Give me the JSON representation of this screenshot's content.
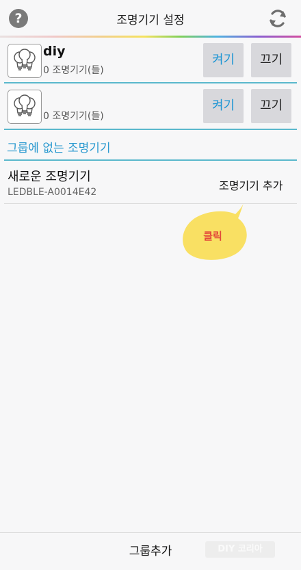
{
  "header": {
    "title": "조명기기 설정",
    "help_icon_glyph": "?",
    "help_icon": "question-circle-icon",
    "refresh_icon": "refresh-icon"
  },
  "groups": [
    {
      "name": "diy",
      "count_label": "0 조명기기(들)",
      "on_label": "켜기",
      "off_label": "끄기"
    },
    {
      "name": "",
      "count_label": "0 조명기기(들)",
      "on_label": "켜기",
      "off_label": "끄기"
    }
  ],
  "ungrouped": {
    "section_title": "그룹에 없는 조명기기",
    "devices": [
      {
        "name": "새로운 조명기기",
        "mac": "LEDBLE-A0014E42",
        "action_label": "조명기기 추가"
      }
    ]
  },
  "annotation": {
    "bubble_text": "클릭"
  },
  "footer": {
    "add_group_label": "그룹추가"
  },
  "colors": {
    "accent_blue": "#2b9ad0",
    "separator_blue": "#5ab8cc",
    "button_bg": "#d8d8dc",
    "on_text": "#1b95d4",
    "bubble_fill": "#f9e063",
    "bubble_text": "#e24a3a"
  }
}
